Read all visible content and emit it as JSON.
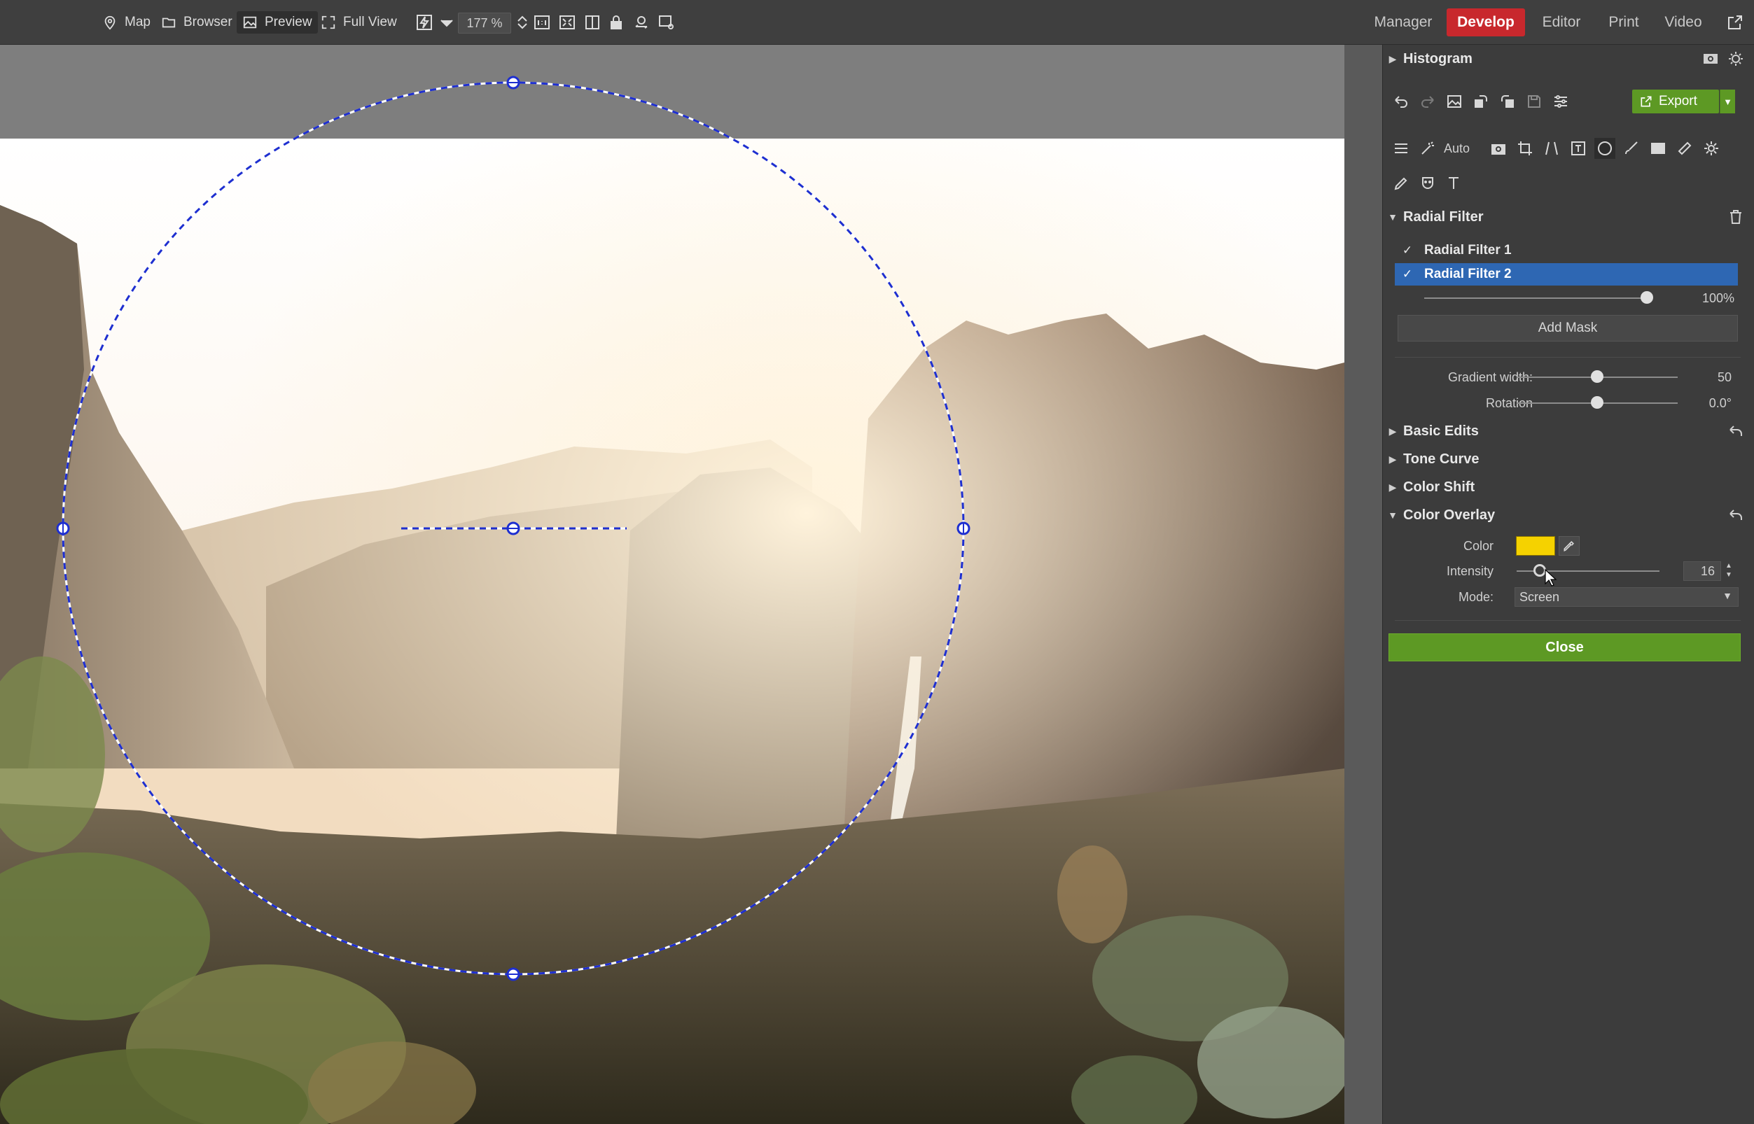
{
  "toolbar": {
    "map_label": "Map",
    "browser_label": "Browser",
    "preview_label": "Preview",
    "fullview_label": "Full View",
    "zoom_value": "177 %"
  },
  "modes": {
    "manager": "Manager",
    "develop": "Develop",
    "editor": "Editor",
    "print": "Print",
    "video": "Video"
  },
  "panel": {
    "histogram_title": "Histogram",
    "export_label": "Export",
    "auto_label": "Auto",
    "radial_filter_title": "Radial Filter",
    "filters": [
      {
        "label": "Radial Filter 1",
        "checked": true,
        "selected": false
      },
      {
        "label": "Radial Filter 2",
        "checked": true,
        "selected": true
      }
    ],
    "opacity_value": "100%",
    "opacity_fraction": 1.0,
    "add_mask_label": "Add Mask",
    "gradient_width": {
      "label": "Gradient width:",
      "value": "50",
      "fraction": 0.5
    },
    "rotation": {
      "label": "Rotation",
      "value": "0.0°",
      "fraction": 0.5
    },
    "basic_edits_title": "Basic Edits",
    "tone_curve_title": "Tone Curve",
    "color_shift_title": "Color Shift",
    "color_overlay_title": "Color Overlay",
    "color_label": "Color",
    "overlay_color": "#f5d200",
    "intensity": {
      "label": "Intensity",
      "value": "16",
      "fraction": 0.16
    },
    "mode_label": "Mode:",
    "mode_value": "Screen",
    "close_label": "Close"
  },
  "colors": {
    "develop_accent": "#c8282d",
    "selection_blue": "#2e67b3",
    "close_green": "#5d9924",
    "filter_outline": "#1e2fd0"
  }
}
